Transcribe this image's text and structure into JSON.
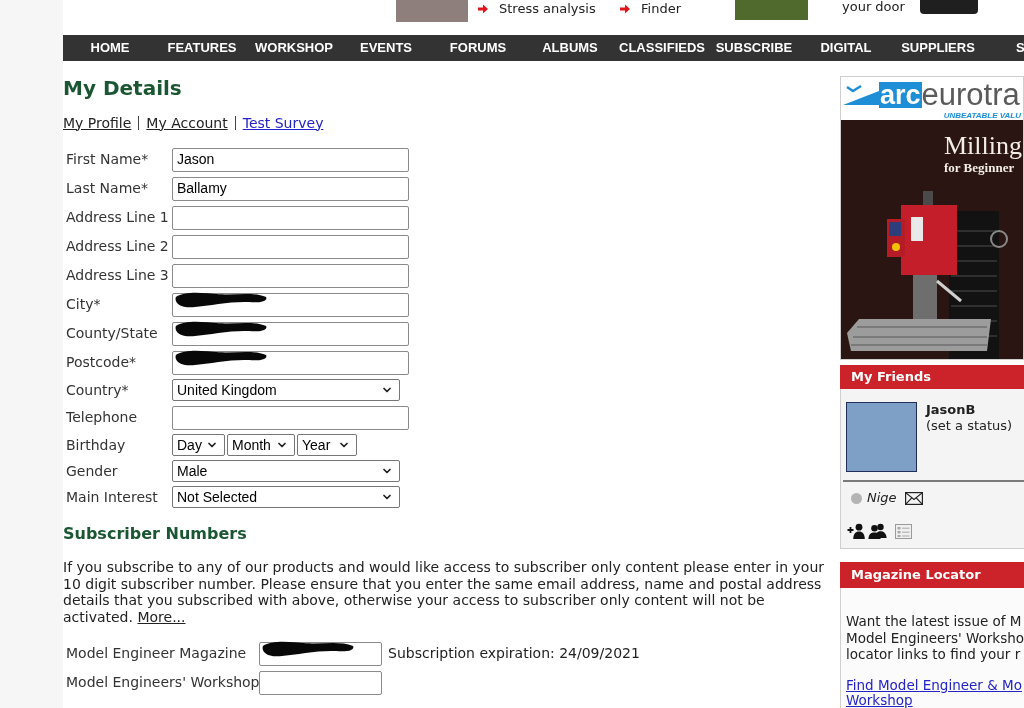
{
  "promo_strip": [
    {
      "kind": "image"
    },
    {
      "kind": "link",
      "text": "Stress analysis"
    },
    {
      "kind": "link",
      "text": "Finder"
    },
    {
      "kind": "image"
    },
    {
      "kind": "text",
      "text": "your door"
    },
    {
      "kind": "image"
    }
  ],
  "nav": [
    "HOME",
    "FEATURES",
    "WORKSHOP",
    "EVENTS",
    "FORUMS",
    "ALBUMS",
    "CLASSIFIEDS",
    "SUBSCRIBE",
    "DIGITAL",
    "SUPPLIERS",
    "S"
  ],
  "page": {
    "title": "My Details",
    "links": [
      {
        "label": "My Profile",
        "visited": true
      },
      {
        "label": "My Account",
        "visited": true
      },
      {
        "label": "Test Survey",
        "visited": false
      }
    ]
  },
  "form": {
    "fields": [
      {
        "label": "First Name*",
        "kind": "text",
        "value": "Jason",
        "redacted": false
      },
      {
        "label": "Last Name*",
        "kind": "text",
        "value": "Ballamy",
        "redacted": false
      },
      {
        "label": "Address Line 1",
        "kind": "text",
        "redacted": false
      },
      {
        "label": "Address Line 2",
        "kind": "text",
        "redacted": false
      },
      {
        "label": "Address Line 3",
        "kind": "text",
        "redacted": false
      },
      {
        "label": "City*",
        "kind": "text",
        "redacted": true
      },
      {
        "label": "County/State",
        "kind": "text",
        "redacted": true
      },
      {
        "label": "Postcode*",
        "kind": "text",
        "redacted": true
      },
      {
        "label": "Country*",
        "kind": "select",
        "value": "United Kingdom"
      },
      {
        "label": "Telephone",
        "kind": "text",
        "redacted": false
      },
      {
        "label": "Birthday",
        "kind": "date",
        "parts": [
          "Day",
          "Month",
          "Year"
        ]
      },
      {
        "label": "Gender",
        "kind": "select",
        "value": "Male"
      },
      {
        "label": "Main Interest",
        "kind": "select",
        "value": "Not Selected"
      }
    ]
  },
  "subscriber_numbers": {
    "title": "Subscriber Numbers",
    "intro": "If you subscribe to any of our products and would like access to subscriber only content please enter in your 10 digit subscriber number. Please ensure that you enter the same email address, name and postal address details that you subscribed with above, otherwise your access to subscriber only content will not be activated.",
    "more_link": "More...",
    "rows": [
      {
        "label": "Model Engineer Magazine",
        "redacted": true,
        "expiry": "Subscription expiration: 24/09/2021"
      },
      {
        "label": "Model Engineers' Workshop",
        "redacted": false
      }
    ]
  },
  "sidebar": {
    "ad": {
      "logo_mark": "arc",
      "logo_word": "eurotra",
      "tagline": "UNBEATABLE VALU",
      "headline": "Milling",
      "subline": "for Beginner"
    },
    "my_friends": {
      "title": "My Friends",
      "user": {
        "name": "JasonB",
        "status": "(set a status)"
      },
      "friends": [
        {
          "name": "Nige",
          "online": false
        }
      ]
    },
    "magazine_locator": {
      "title": "Magazine Locator",
      "text_lines": [
        "Want the latest issue of M",
        "Model Engineers' Worksho",
        "locator links to find your r"
      ],
      "link_lines": [
        "Find Model Engineer & Mo",
        "Workshop"
      ]
    }
  }
}
